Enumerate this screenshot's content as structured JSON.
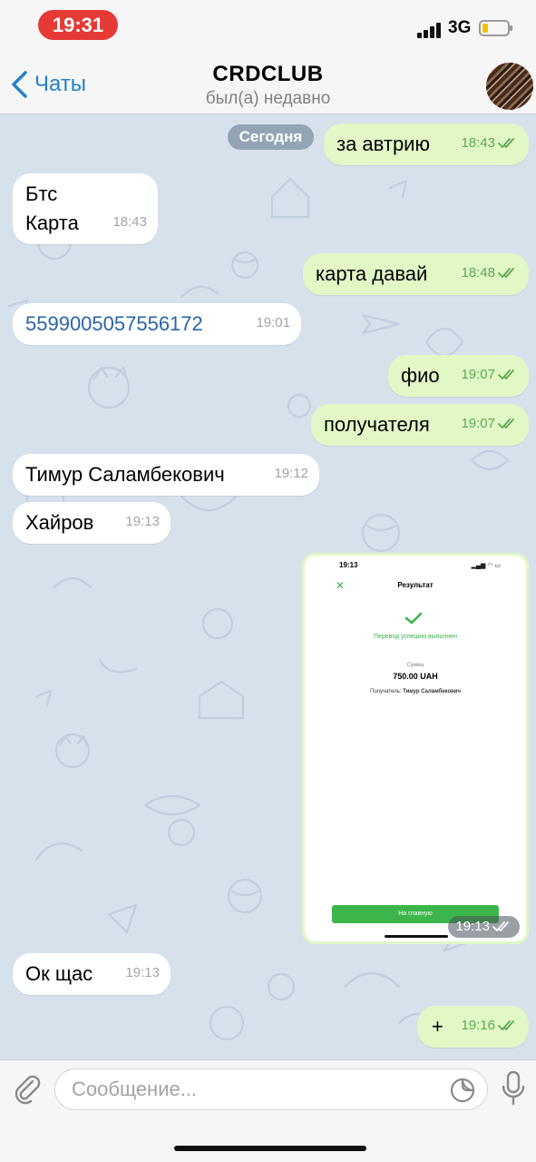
{
  "status_bar": {
    "time": "19:31",
    "network": "3G"
  },
  "header": {
    "back_label": "Чаты",
    "title": "CRDCLUB",
    "subtitle": "был(а) недавно"
  },
  "chat": {
    "date_separator": "Сегодня",
    "messages": [
      {
        "direction": "out",
        "text": "за автрию",
        "time": "18:43",
        "read": true
      },
      {
        "direction": "in",
        "lines": [
          "Бтс",
          "Карта"
        ],
        "time": "18:43"
      },
      {
        "direction": "out",
        "text": "карта давай",
        "time": "18:48",
        "read": true
      },
      {
        "direction": "in",
        "text": "5599005057556172",
        "time": "19:01",
        "is_link": true
      },
      {
        "direction": "out",
        "text": "фио",
        "time": "19:07",
        "read": true
      },
      {
        "direction": "out",
        "text": "получателя",
        "time": "19:07",
        "read": true
      },
      {
        "direction": "in",
        "text": "Тимур Саламбекович",
        "time": "19:12"
      },
      {
        "direction": "in",
        "text": "Хайров",
        "time": "19:13"
      },
      {
        "direction": "out",
        "type": "photo",
        "time": "19:13",
        "read": true
      },
      {
        "direction": "in",
        "text": "Ок щас",
        "time": "19:13"
      },
      {
        "direction": "out",
        "text": "+",
        "time": "19:16",
        "read": true
      }
    ],
    "photo_content": {
      "time": "19:13",
      "title": "Результат",
      "status": "Перевод успешно выполнен",
      "amount_label": "Сумма",
      "amount": "750.00 UAH",
      "recipient_label": "Получатель:",
      "recipient": "Тимур Саламбекович",
      "button": "На главную"
    }
  },
  "input": {
    "placeholder": "Сообщение..."
  },
  "icons": {
    "back": "chevron-left-icon",
    "attach": "paperclip-icon",
    "sticker": "sticker-icon",
    "mic": "microphone-icon",
    "read": "double-check-icon"
  },
  "colors": {
    "accent": "#2481cc",
    "outgoing_bubble": "#e1f7c6",
    "incoming_bubble": "#ffffff",
    "time_pill": "#e63a36",
    "success_green": "#3cb64a"
  }
}
